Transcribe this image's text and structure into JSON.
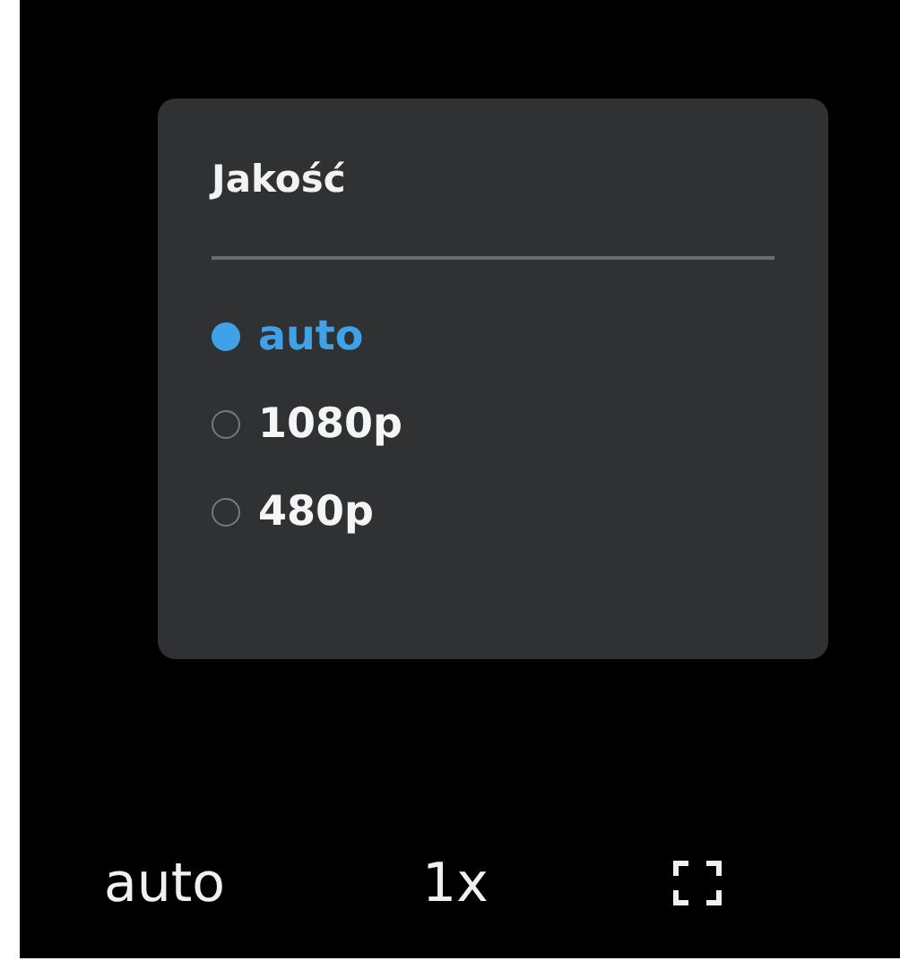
{
  "quality_menu": {
    "title": "Jakość",
    "options": [
      {
        "label": "auto",
        "selected": true
      },
      {
        "label": "1080p",
        "selected": false
      },
      {
        "label": "480p",
        "selected": false
      }
    ]
  },
  "control_bar": {
    "quality": "auto",
    "speed": "1x"
  }
}
